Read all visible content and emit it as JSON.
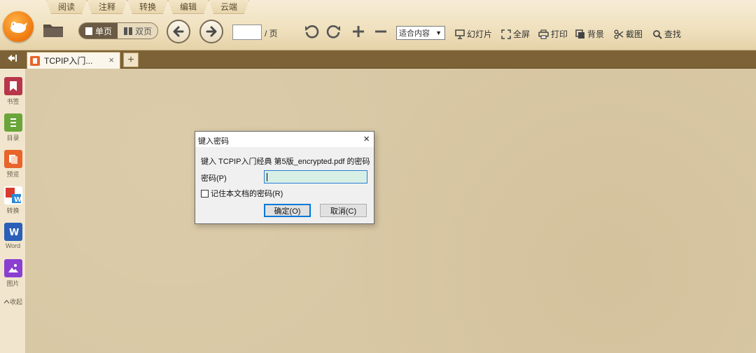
{
  "menu": {
    "tabs": [
      "阅读",
      "注释",
      "转换",
      "编辑",
      "云端"
    ]
  },
  "toolbar": {
    "single_page_label": "单页",
    "double_page_label": "双页",
    "page_value": "",
    "page_suffix": "/ 页",
    "zoom_value": "适合内容",
    "slideshow_label": "幻灯片",
    "fullscreen_label": "全屏",
    "print_label": "打印",
    "background_label": "背景",
    "screenshot_label": "截图",
    "search_label": "查找"
  },
  "tabs": {
    "document_title": "TCPIP入门...",
    "close_symbol": "×",
    "new_tab_symbol": "+"
  },
  "sidebar": {
    "items": [
      {
        "label": "书签",
        "icon": "bookmark-icon",
        "color": "#b8364a"
      },
      {
        "label": "目录",
        "icon": "toc-icon",
        "color": "#6aa53a"
      },
      {
        "label": "预览",
        "icon": "preview-icon",
        "color": "#e8642b"
      },
      {
        "label": "转换",
        "icon": "convert-icon",
        "color": "#d83b2e"
      },
      {
        "label": "Word",
        "icon": "word-icon",
        "color": "#2b5fb8"
      },
      {
        "label": "图片",
        "icon": "image-icon",
        "color": "#8a3fd1"
      }
    ],
    "collapse_label": "收起"
  },
  "dialog": {
    "title": "键入密码",
    "close_symbol": "×",
    "prompt": "键入 TCPIP入门经典 第5版_encrypted.pdf 的密码",
    "password_label": "密码(P)",
    "password_value": "",
    "remember_label": "记住本文档的密码(R)",
    "remember_checked": false,
    "ok_label": "确定(O)",
    "cancel_label": "取消(C)"
  },
  "colors": {
    "toolbar_bg": "#efe0bd",
    "tabstrip_bg": "#7c6236",
    "content_bg": "#d9c8a4",
    "accent_orange": "#f07d12",
    "focus_blue": "#0078d7"
  }
}
